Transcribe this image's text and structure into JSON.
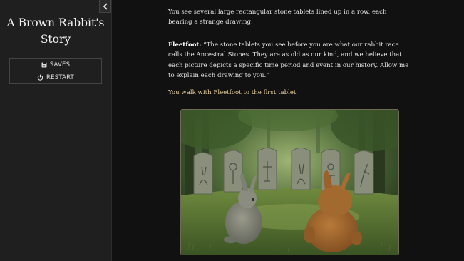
{
  "sidebar": {
    "title_line1": "A Brown Rabbit's",
    "title_line2": "Story",
    "menu": [
      {
        "label": "SAVES",
        "icon": "save-icon"
      },
      {
        "label": "RESTART",
        "icon": "power-icon"
      }
    ],
    "collapse_icon": "chevron-left-icon"
  },
  "passage": {
    "intro": "You see several large rectangular stone tablets lined up in a row, each bearing a strange drawing.",
    "speaker": "Fleetfoot:",
    "speech": " “The stone tablets you see before you are what our rabbit race calls the Ancestral Stones. They are as old as our kind, and we believe that each picture depicts a specific time period and event in our history. Allow me to explain each drawing to you.”",
    "link": "You walk with Fleetfoot to the first tablet"
  },
  "colors": {
    "background": "#111111",
    "sidebar": "#1f1f1f",
    "link": "#e9cf9a"
  }
}
